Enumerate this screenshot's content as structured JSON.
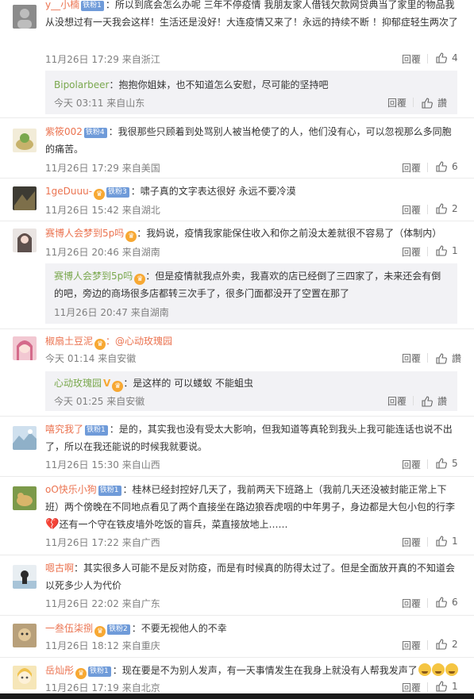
{
  "common": {
    "reply": "回覆",
    "like_text": "讚"
  },
  "comments": [
    {
      "user": "y__小楠",
      "badge": "铁粉1",
      "text": "：所以到底会怎么办呢 三年不停疫情 我朋友家人借钱欠款网贷典当了家里的物品我从没想过有一天我会这样！生活还是没好！大连疫情又来了！永远的持续不断 ！抑郁症轻生两次了",
      "time": "11月26日 17:29 来自浙江",
      "likes": "4"
    },
    {
      "user": "紫筱002",
      "badge": "铁粉4",
      "text": "：我很那些只顾着到处骂别人被当枪使了的人，他们没有心，可以忽视那么多同胞的痛苦。",
      "time": "11月26日 17:29 来自美国",
      "likes": "6"
    },
    {
      "user": "1geDuuu-",
      "badge": "铁粉3",
      "text": "：啸子真的文字表达很好 永远不要冷漠",
      "time": "11月26日 15:42 来自湖北",
      "likes": "2"
    },
    {
      "user": "赛博人会梦到5p吗",
      "badge": "",
      "text": "：我妈说，疫情我家能保住收入和你之前没太差就很不容易了（体制内）",
      "time": "11月26日 20:46 来自湖南",
      "likes": "1"
    },
    {
      "user": "椒扇土豆泥",
      "badge": "",
      "text": "：@心动玫瑰园",
      "time": "今天 01:14 来自安徽",
      "likes": ""
    },
    {
      "user": "嘻究我了",
      "badge": "铁粉1",
      "text": "：是的，其实我也没有受太大影响，但我知道等真轮到我头上我可能连话也说不出了，所以在我还能说的时候我就要说。",
      "time": "11月26日 15:30 来自山西",
      "likes": "5"
    },
    {
      "user": "oO快乐小狗",
      "badge": "铁粉1",
      "text": "：桂林已经封控好几天了，我前两天下班路上（我前几天还没被封能正常上下班）两个傍晚在不同地点看见了两个直接坐在路边狼吞虎咽的中年男子，身边都是大包小包的行李",
      "text2": "还有一个守在铁皮墙外吃饭的盲兵，菜直接放地上……",
      "time": "11月26日 17:22 来自广西",
      "likes": "1"
    },
    {
      "user": "嗯古啊",
      "badge": "",
      "text": "：其实很多人可能不是反对防疫，而是有时候真的防得太过了。但是全面放开真的不知道会以死多少人为代价",
      "time": "11月26日 22:02 来自广东",
      "likes": "6"
    },
    {
      "user": "一叁伍柒捌",
      "badge": "铁粉2",
      "text": "：不要无视他人的不幸",
      "time": "11月26日 18:12 来自重庆",
      "likes": "2"
    },
    {
      "user": "岳灿彤",
      "badge": "铁粉1",
      "text": "：现在要是不为别人发声，有一天事情发生在我身上就没有人帮我发声了",
      "time": "11月26日 17:19 来自北京",
      "likes": "1"
    }
  ],
  "replies": [
    {
      "user": "Bipolarbeer",
      "text": "：抱抱你姐妹，也不知道怎么安慰，尽可能的坚持吧",
      "time": "今天 03:11 来自山东"
    },
    {
      "user": "赛博人会梦到5p吗",
      "text": "：但是疫情就我点外卖，我喜欢的店已经倒了三四家了，未来还会有倒的吧，旁边的商场很多店都转三次手了，很多门面都没开了空置在那了",
      "time": "11月26日 20:47 来自湖南"
    },
    {
      "user": "心动玫瑰园",
      "text": "：是这样的 可以蝼蚁 不能蛆虫",
      "time": "今天 01:25 来自安徽"
    }
  ]
}
